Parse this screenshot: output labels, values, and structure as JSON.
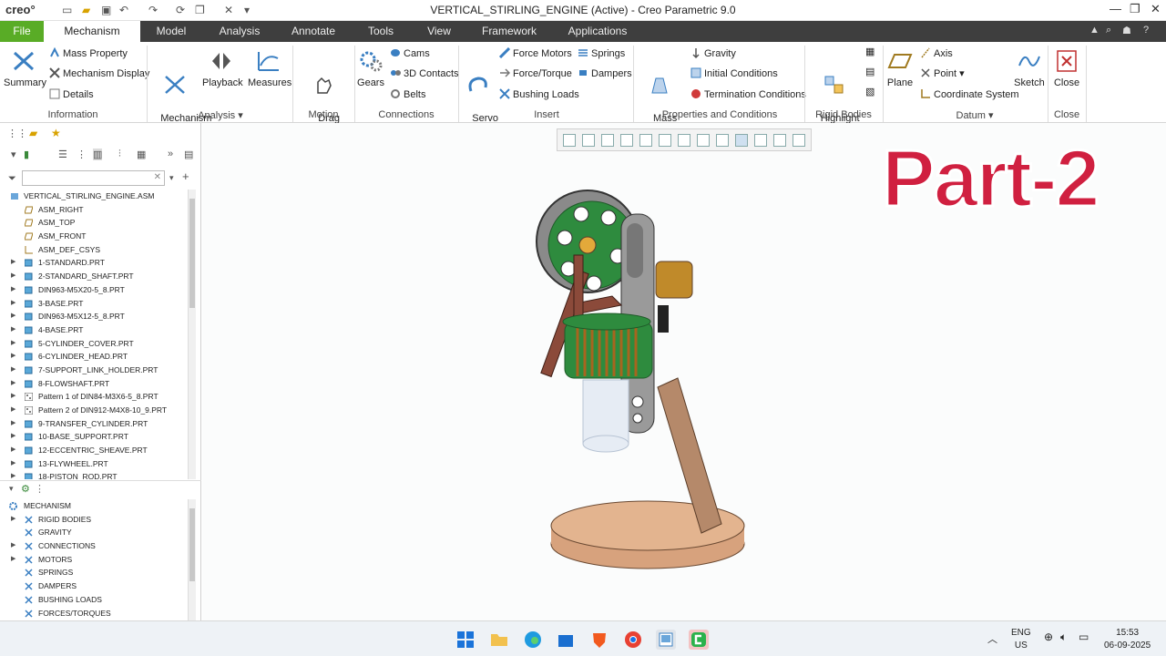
{
  "app": {
    "logo": "creo°",
    "window_title": "VERTICAL_STIRLING_ENGINE (Active) - Creo Parametric 9.0"
  },
  "ribbon_tabs": [
    "File",
    "Mechanism",
    "Model",
    "Analysis",
    "Annotate",
    "Tools",
    "View",
    "Framework",
    "Applications"
  ],
  "ribbon": {
    "summary": "Summary",
    "mass_property": "Mass Property",
    "mech_display": "Mechanism Display",
    "details": "Details",
    "mech_analysis": "Mechanism\nAnalysis",
    "playback": "Playback",
    "measures": "Measures",
    "drag": "Drag\nComponents",
    "gears": "Gears",
    "cams": "Cams",
    "contacts": "3D Contacts",
    "belts": "Belts",
    "servo": "Servo\nMotors",
    "force_motors": "Force Motors",
    "force_torque": "Force/Torque",
    "bushing": "Bushing Loads",
    "springs": "Springs",
    "dampers": "Dampers",
    "mass_props": "Mass\nProperties",
    "gravity": "Gravity",
    "initial": "Initial Conditions",
    "termination": "Termination Conditions",
    "highlight": "Highlight\nRigid Bodies",
    "plane": "Plane",
    "axis": "Axis",
    "point": "Point",
    "csys": "Coordinate System",
    "sketch": "Sketch",
    "close": "Close",
    "groups": {
      "information": "Information",
      "analysis": "Analysis",
      "motion": "Motion",
      "connections": "Connections",
      "insert": "Insert",
      "props": "Properties and Conditions",
      "rigid": "Rigid Bodies",
      "datum": "Datum",
      "close": "Close"
    }
  },
  "model_tree": {
    "root": "VERTICAL_STIRLING_ENGINE.ASM",
    "items": [
      {
        "label": "ASM_RIGHT",
        "kind": "plane",
        "expand": false
      },
      {
        "label": "ASM_TOP",
        "kind": "plane",
        "expand": false
      },
      {
        "label": "ASM_FRONT",
        "kind": "plane",
        "expand": false
      },
      {
        "label": "ASM_DEF_CSYS",
        "kind": "csys",
        "expand": false
      },
      {
        "label": "1-STANDARD.PRT",
        "kind": "part",
        "expand": true
      },
      {
        "label": "2-STANDARD_SHAFT.PRT",
        "kind": "part",
        "expand": true
      },
      {
        "label": "DIN963-M5X20-5_8.PRT",
        "kind": "part",
        "expand": true
      },
      {
        "label": "3-BASE.PRT",
        "kind": "part",
        "expand": true
      },
      {
        "label": "DIN963-M5X12-5_8.PRT",
        "kind": "part",
        "expand": true
      },
      {
        "label": "4-BASE.PRT",
        "kind": "part",
        "expand": true
      },
      {
        "label": "5-CYLINDER_COVER.PRT",
        "kind": "part",
        "expand": true
      },
      {
        "label": "6-CYLINDER_HEAD.PRT",
        "kind": "part",
        "expand": true
      },
      {
        "label": "7-SUPPORT_LINK_HOLDER.PRT",
        "kind": "part",
        "expand": true
      },
      {
        "label": "8-FLOWSHAFT.PRT",
        "kind": "part",
        "expand": true
      },
      {
        "label": "Pattern 1 of DIN84-M3X6-5_8.PRT",
        "kind": "pattern",
        "expand": true
      },
      {
        "label": "Pattern 2 of DIN912-M4X8-10_9.PRT",
        "kind": "pattern",
        "expand": true
      },
      {
        "label": "9-TRANSFER_CYLINDER.PRT",
        "kind": "part",
        "expand": true
      },
      {
        "label": "10-BASE_SUPPORT.PRT",
        "kind": "part",
        "expand": true
      },
      {
        "label": "12-ECCENTRIC_SHEAVE.PRT",
        "kind": "part",
        "expand": true
      },
      {
        "label": "13-FLYWHEEL.PRT",
        "kind": "part",
        "expand": true
      },
      {
        "label": "18-PISTON_ROD.PRT",
        "kind": "part",
        "expand": true
      }
    ]
  },
  "mech_tree": {
    "root": "MECHANISM",
    "items": [
      {
        "label": "RIGID BODIES",
        "expand": true
      },
      {
        "label": "GRAVITY",
        "expand": false
      },
      {
        "label": "CONNECTIONS",
        "expand": true
      },
      {
        "label": "MOTORS",
        "expand": true
      },
      {
        "label": "SPRINGS",
        "expand": false
      },
      {
        "label": "DAMPERS",
        "expand": false
      },
      {
        "label": "BUSHING LOADS",
        "expand": false
      },
      {
        "label": "FORCES/TORQUES",
        "expand": false
      }
    ]
  },
  "overlay_text": "Part-2",
  "taskbar": {
    "lang1": "ENG",
    "lang2": "US",
    "time": "15:53",
    "date": "06-09-2025"
  },
  "colors": {
    "file_tab": "#59ac26",
    "ribbon_dark": "#3e3e3e",
    "overlay": "#d02040"
  }
}
